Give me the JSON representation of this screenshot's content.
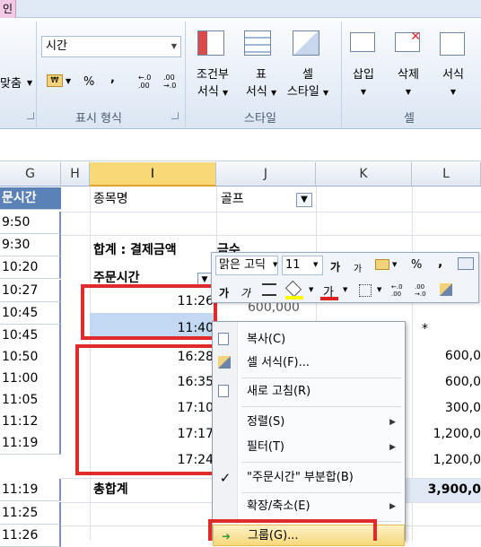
{
  "ribbon": {
    "tab_partial": "인",
    "number_format": "시간",
    "align_partial": "맞춤",
    "currency": "₩",
    "percent": "%",
    "comma": ",",
    "dec_inc": "←.0\n.00",
    "dec_dec": ".00\n→.0",
    "group_number": "표시 형식",
    "cond_fmt": [
      "조건부",
      "서식"
    ],
    "table_fmt": [
      "표",
      "서식"
    ],
    "cell_style": [
      "셀",
      "스타일"
    ],
    "group_style": "스타일",
    "insert": "삽입",
    "delete": "삭제",
    "format": "서식",
    "group_cells": "셀"
  },
  "columns": [
    "G",
    "H",
    "I",
    "J",
    "K",
    "L"
  ],
  "colG": {
    "header": "문시간",
    "values": [
      "9:50",
      "9:30",
      "10:20",
      "10:27",
      "10:45",
      "10:45",
      "10:50",
      "11:00",
      "11:05",
      "11:12",
      "11:19",
      "11:25",
      "11:26"
    ]
  },
  "pivot": {
    "filter_label": "종목명",
    "filter_value": "골프",
    "sum_label": "합계 : 결제금액",
    "sum_partial": "금수",
    "row_header": "주문시간",
    "times": [
      "11:26",
      "11:40",
      "16:28",
      "16:35",
      "17:10",
      "17:17",
      "17:24"
    ],
    "j_partial": "600,000",
    "star": "*",
    "amounts": [
      "600,0",
      "600,0",
      "300,0",
      "1,200,0",
      "1,200,0"
    ],
    "total_label": "총합계",
    "total_value": "3,900,0"
  },
  "mini_toolbar": {
    "font": "맑은 고딕",
    "size": "11",
    "grow": "가",
    "shrink": "가",
    "percent": "%",
    "comma": ",",
    "bold": "가",
    "italic": "가",
    "font_color_glyph": "가"
  },
  "context_menu": {
    "items": [
      {
        "label": "복사(C)",
        "icon": "copy-icon"
      },
      {
        "label": "셀 서식(F)...",
        "icon": "format-cells-icon"
      },
      {
        "label": "새로 고침(R)",
        "icon": "refresh-icon"
      },
      {
        "label": "정렬(S)",
        "icon": ""
      },
      {
        "label": "필터(T)",
        "icon": ""
      },
      {
        "label": "\"주문시간\" 부분합(B)",
        "icon": "check-icon"
      },
      {
        "label": "확장/축소(E)",
        "icon": ""
      },
      {
        "label": "그룹(G)...",
        "icon": "group-icon"
      }
    ],
    "check": "✓"
  }
}
